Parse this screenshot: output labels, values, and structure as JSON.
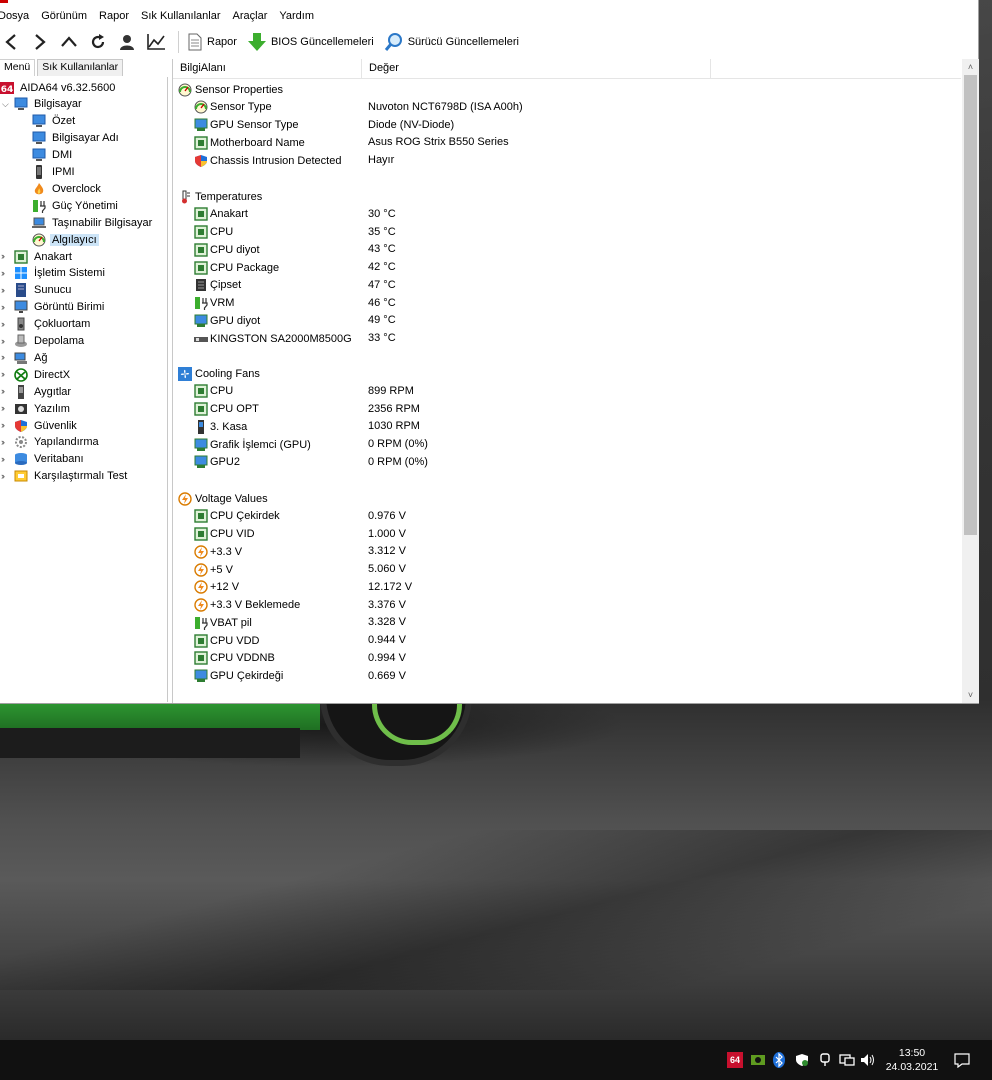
{
  "menu": [
    "Dosya",
    "Görünüm",
    "Rapor",
    "Sık Kullanılanlar",
    "Araçlar",
    "Yardım"
  ],
  "toolbar": {
    "report_label": "Rapor",
    "bios_label": "BIOS Güncellemeleri",
    "driver_label": "Sürücü Güncellemeleri"
  },
  "tabs": [
    "Menü",
    "Sık Kullanılanlar"
  ],
  "tree": [
    {
      "label": "AIDA64 v6.32.5600",
      "icon": "aida64-logo-icon"
    },
    {
      "label": "Bilgisayar",
      "icon": "computer-icon"
    },
    {
      "label": "Özet",
      "icon": "monitor-icon"
    },
    {
      "label": "Bilgisayar Adı",
      "icon": "monitor-icon"
    },
    {
      "label": "DMI",
      "icon": "monitor-icon"
    },
    {
      "label": "IPMI",
      "icon": "phone-icon"
    },
    {
      "label": "Overclock",
      "icon": "flame-icon"
    },
    {
      "label": "Güç Yönetimi",
      "icon": "battery-icon"
    },
    {
      "label": "Taşınabilir Bilgisayar",
      "icon": "laptop-icon"
    },
    {
      "label": "Algılayıcı",
      "icon": "gauge-icon"
    },
    {
      "label": "Anakart",
      "icon": "motherboard-icon"
    },
    {
      "label": "İşletim Sistemi",
      "icon": "windows-icon"
    },
    {
      "label": "Sunucu",
      "icon": "server-icon"
    },
    {
      "label": "Görüntü Birimi",
      "icon": "display-icon"
    },
    {
      "label": "Çokluortam",
      "icon": "speaker-icon"
    },
    {
      "label": "Depolama",
      "icon": "disk-icon"
    },
    {
      "label": "Ağ",
      "icon": "network-icon"
    },
    {
      "label": "DirectX",
      "icon": "xbox-icon"
    },
    {
      "label": "Aygıtlar",
      "icon": "device-icon"
    },
    {
      "label": "Yazılım",
      "icon": "software-icon"
    },
    {
      "label": "Güvenlik",
      "icon": "shield-icon"
    },
    {
      "label": "Yapılandırma",
      "icon": "config-icon"
    },
    {
      "label": "Veritabanı",
      "icon": "database-icon"
    },
    {
      "label": "Karşılaştırmalı Test",
      "icon": "benchmark-icon"
    }
  ],
  "columns": [
    "BilgiAlanı",
    "Değer"
  ],
  "sections": {
    "sensor": "Sensor Properties",
    "temps": "Temperatures",
    "fans": "Cooling Fans",
    "volts": "Voltage Values"
  },
  "rows": {
    "sensor": [
      {
        "label": "Sensor Type",
        "value": "Nuvoton NCT6798D  (ISA A00h)"
      },
      {
        "label": "GPU Sensor Type",
        "value": "Diode  (NV-Diode)"
      },
      {
        "label": "Motherboard Name",
        "value": "Asus ROG Strix B550 Series"
      },
      {
        "label": "Chassis Intrusion Detected",
        "value": "Hayır"
      }
    ],
    "temps": [
      {
        "label": "Anakart",
        "value": "30 °C"
      },
      {
        "label": "CPU",
        "value": "35 °C"
      },
      {
        "label": "CPU diyot",
        "value": "43 °C"
      },
      {
        "label": "CPU Package",
        "value": "42 °C"
      },
      {
        "label": "Çipset",
        "value": "47 °C"
      },
      {
        "label": "VRM",
        "value": "46 °C"
      },
      {
        "label": "GPU diyot",
        "value": "49 °C"
      },
      {
        "label": "KINGSTON SA2000M8500G",
        "value": "33 °C"
      }
    ],
    "fans": [
      {
        "label": "CPU",
        "value": "899 RPM"
      },
      {
        "label": "CPU OPT",
        "value": "2356 RPM"
      },
      {
        "label": "3. Kasa",
        "value": "1030 RPM"
      },
      {
        "label": "Grafik İşlemci (GPU)",
        "value": "0 RPM  (0%)"
      },
      {
        "label": "GPU2",
        "value": "0 RPM  (0%)"
      }
    ],
    "volts": [
      {
        "label": "CPU Çekirdek",
        "value": "0.976 V"
      },
      {
        "label": "CPU VID",
        "value": "1.000 V"
      },
      {
        "label": "+3.3 V",
        "value": "3.312 V"
      },
      {
        "label": "+5 V",
        "value": "5.060 V"
      },
      {
        "label": "+12 V",
        "value": "12.172 V"
      },
      {
        "label": "+3.3 V Beklemede",
        "value": "3.376 V"
      },
      {
        "label": "VBAT pil",
        "value": "3.328 V"
      },
      {
        "label": "CPU VDD",
        "value": "0.944 V"
      },
      {
        "label": "CPU VDDNB",
        "value": "0.994 V"
      },
      {
        "label": "GPU Çekirdeği",
        "value": "0.669 V"
      }
    ]
  },
  "taskbar": {
    "time": "13:50",
    "date": "24.03.2021",
    "aida_badge": "64"
  },
  "colors": {
    "selection": "#cce4f7",
    "aida_red": "#c8102e",
    "chip_green": "#2e7d32",
    "taskbar": "#111111"
  }
}
